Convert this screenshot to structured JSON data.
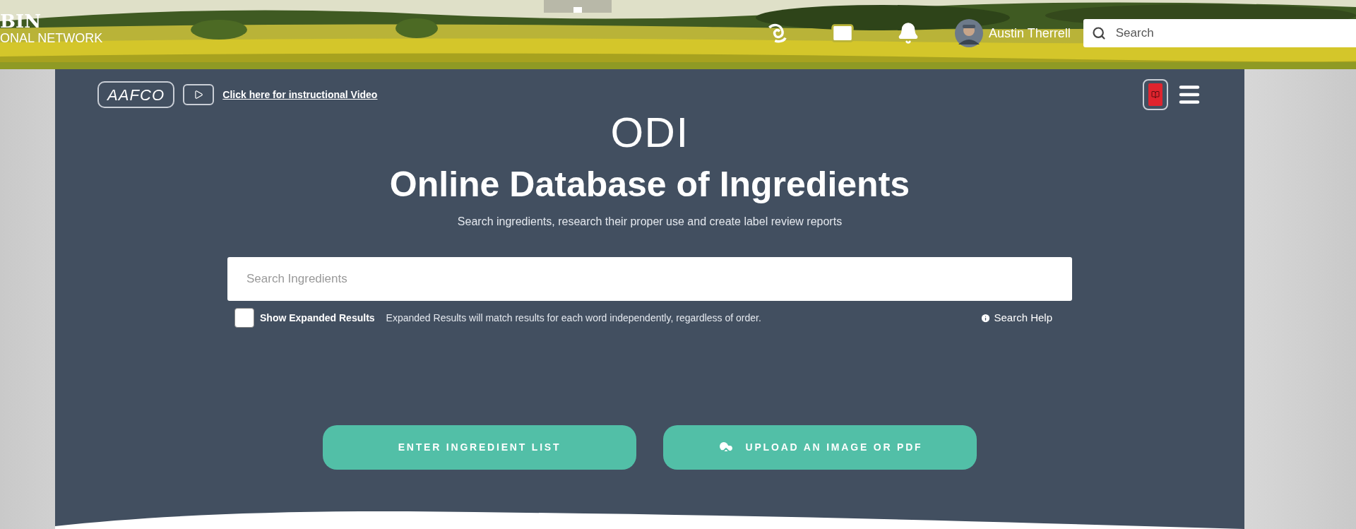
{
  "header": {
    "brand_title": "BIN",
    "brand_subtitle": "ONAL NETWORK",
    "user_name": "Austin Therrell",
    "search": {
      "placeholder": "Search"
    }
  },
  "toolbar": {
    "logo": "AAFCO",
    "video_link": "Click here for instructional Video"
  },
  "hero": {
    "acronym": "ODI",
    "title": "Online Database of Ingredients",
    "subtitle": "Search ingredients, research their proper use and create label review reports"
  },
  "ingredient_search": {
    "placeholder": "Search Ingredients"
  },
  "expanded_results": {
    "label": "Show Expanded Results",
    "checked": false,
    "hint": "Expanded Results will match results for each word independently, regardless of order."
  },
  "help_link": "Search Help",
  "buttons": [
    {
      "label": "ENTER INGREDIENT LIST",
      "kind": "plain"
    },
    {
      "label": "UPLOAD AN IMAGE OR PDF",
      "kind": "upload"
    }
  ]
}
